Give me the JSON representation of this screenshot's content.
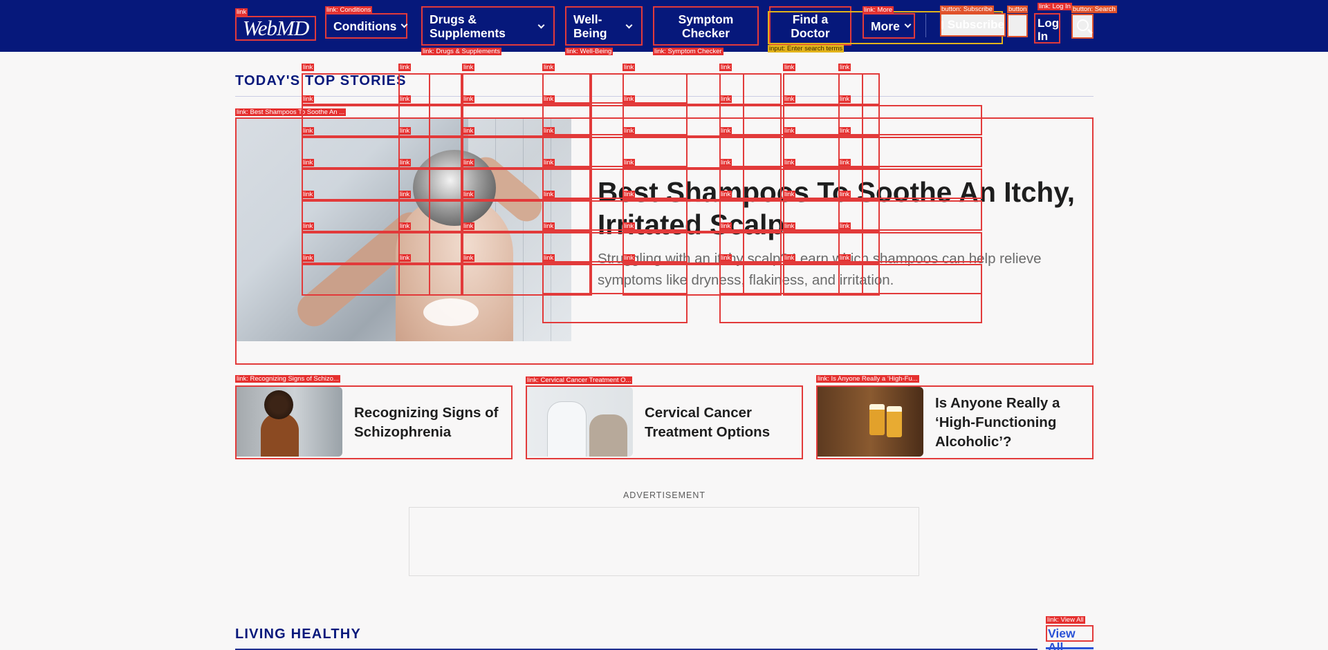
{
  "nav": {
    "logo_text": "WebMD",
    "logo_tag": "link",
    "items": [
      {
        "label": "Conditions",
        "tag": "link: Conditions"
      },
      {
        "label": "Drugs & Supplements",
        "tag": "link: Drugs & Supplements"
      },
      {
        "label": "Well-Being",
        "tag": "link: Well-Being"
      },
      {
        "label": "Symptom Checker",
        "tag": "link: Symptom Checker"
      },
      {
        "label": "Find a Doctor",
        "tag": "link: Find a Doctor"
      },
      {
        "label": "More",
        "tag": "link: More"
      }
    ],
    "search_tag": "input: Enter search terms",
    "subscribe_label": "Subscribe",
    "subscribe_tag": "button: Subscribe",
    "close_tag": "button",
    "login_label": "Log In",
    "login_tag": "link: Log In",
    "search_button_tag": "button: Search"
  },
  "top_stories": {
    "title": "TODAY'S TOP STORIES",
    "overlay_tag": "link",
    "hero": {
      "tag": "link: Best Shampoos To Soothe An ...",
      "title": "Best Shampoos To Soothe An Itchy, Irritated Scalp",
      "description": "Struggling with an itchy scalp? Learn which shampoos can help relieve symptoms like dryness, flakiness, and irritation."
    },
    "cards": [
      {
        "title": "Recognizing Signs of Schizophrenia",
        "tag": "link: Recognizing Signs of Schizo..."
      },
      {
        "title": "Cervical Cancer Treatment Options",
        "tag": "link: Cervical Cancer Treatment O..."
      },
      {
        "title": "Is Anyone Really a ‘High-Functioning Alcoholic’?",
        "tag": "link: Is Anyone Really a ‘High-Fu..."
      }
    ]
  },
  "ad": {
    "label": "ADVERTISEMENT"
  },
  "living_healthy": {
    "title": "LIVING HEALTHY",
    "view_all_label": "View All",
    "view_all_tag": "link: View All"
  },
  "colors": {
    "nav_bg": "#06187b",
    "accent": "#2952d6",
    "overlay": "#e23a3a",
    "background": "#f8f7f7"
  }
}
